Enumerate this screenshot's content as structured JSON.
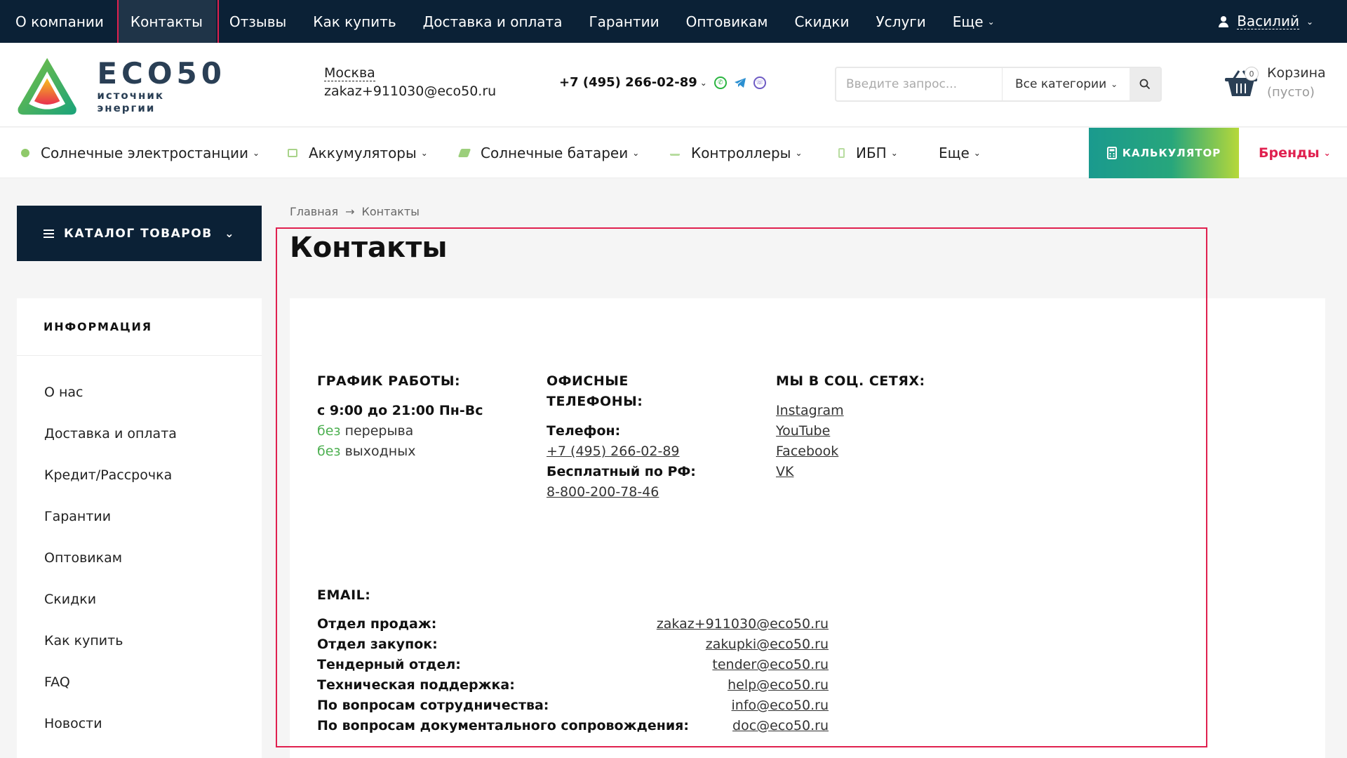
{
  "topnav": {
    "items": [
      {
        "label": "О компании"
      },
      {
        "label": "Контакты"
      },
      {
        "label": "Отзывы"
      },
      {
        "label": "Как купить"
      },
      {
        "label": "Доставка и оплата"
      },
      {
        "label": "Гарантии"
      },
      {
        "label": "Оптовикам"
      },
      {
        "label": "Скидки"
      },
      {
        "label": "Услуги"
      },
      {
        "label": "Еще"
      }
    ],
    "user_name": "Василий"
  },
  "header": {
    "logo_word": "ECO50",
    "logo_sub": "источник энергии",
    "city": "Москва",
    "email": "zakaz+911030@eco50.ru",
    "phone": "+7 (495) 266-02-89",
    "search_placeholder": "Введите запрос...",
    "search_category": "Все категории",
    "cart_label": "Корзина",
    "cart_status": "(пусто)",
    "cart_count": "0"
  },
  "categories": {
    "items": [
      {
        "label": "Солнечные электростанции"
      },
      {
        "label": "Аккумуляторы"
      },
      {
        "label": "Солнечные батареи"
      },
      {
        "label": "Контроллеры"
      },
      {
        "label": "ИБП"
      },
      {
        "label": "Еще"
      }
    ],
    "calculator": "КАЛЬКУЛЯТОР",
    "brands": "Бренды"
  },
  "sidebar": {
    "catalog_label": "КАТАЛОГ ТОВАРОВ",
    "info_title": "ИНФОРМАЦИЯ",
    "items": [
      {
        "label": "О нас"
      },
      {
        "label": "Доставка и оплата"
      },
      {
        "label": "Кредит/Рассрочка"
      },
      {
        "label": "Гарантии"
      },
      {
        "label": "Оптовикам"
      },
      {
        "label": "Скидки"
      },
      {
        "label": "Как купить"
      },
      {
        "label": "FAQ"
      },
      {
        "label": "Новости"
      }
    ]
  },
  "breadcrumb": {
    "home": "Главная",
    "arrow": "→",
    "current": "Контакты"
  },
  "page": {
    "title": "Контакты"
  },
  "schedule": {
    "title": "ГРАФИК РАБОТЫ:",
    "hours": "с 9:00 до 21:00 Пн-Вс",
    "line2_green": "без",
    "line2_rest": "перерыва",
    "line3_green": "без",
    "line3_rest": "выходных"
  },
  "phones": {
    "title_line1": "ОФИСНЫЕ",
    "title_line2": "ТЕЛЕФОНЫ:",
    "phone_label": "Телефон:",
    "phone_value": "+7 (495) 266-02-89",
    "free_label": "Бесплатный по РФ:",
    "free_value": "8-800-200-78-46"
  },
  "social": {
    "title": "МЫ В СОЦ. СЕТЯХ:",
    "links": [
      {
        "label": "Instagram"
      },
      {
        "label": "YouTube"
      },
      {
        "label": "Facebook"
      },
      {
        "label": "VK"
      }
    ]
  },
  "emails": {
    "title": "EMAIL:",
    "rows": [
      {
        "label": "Отдел продаж:",
        "value": "zakaz+911030@eco50.ru"
      },
      {
        "label": "Отдел закупок:",
        "value": "zakupki@eco50.ru"
      },
      {
        "label": "Тендерный отдел:",
        "value": "tender@eco50.ru"
      },
      {
        "label": "Техническая поддержка:",
        "value": "help@eco50.ru"
      },
      {
        "label": "По вопросам сотрудничества:",
        "value": "info@eco50.ru"
      },
      {
        "label": "По вопросам документального сопровождения:",
        "value": "doc@eco50.ru"
      }
    ]
  },
  "colors": {
    "dark_navy": "#0b2136",
    "accent_red": "#e0204f",
    "accent_green": "#4caf50"
  },
  "icons": [
    "user-icon",
    "whatsapp-icon",
    "telegram-icon",
    "viber-icon",
    "search-icon",
    "cart-icon",
    "calculator-icon",
    "menu-icon",
    "chevron-down-icon"
  ]
}
